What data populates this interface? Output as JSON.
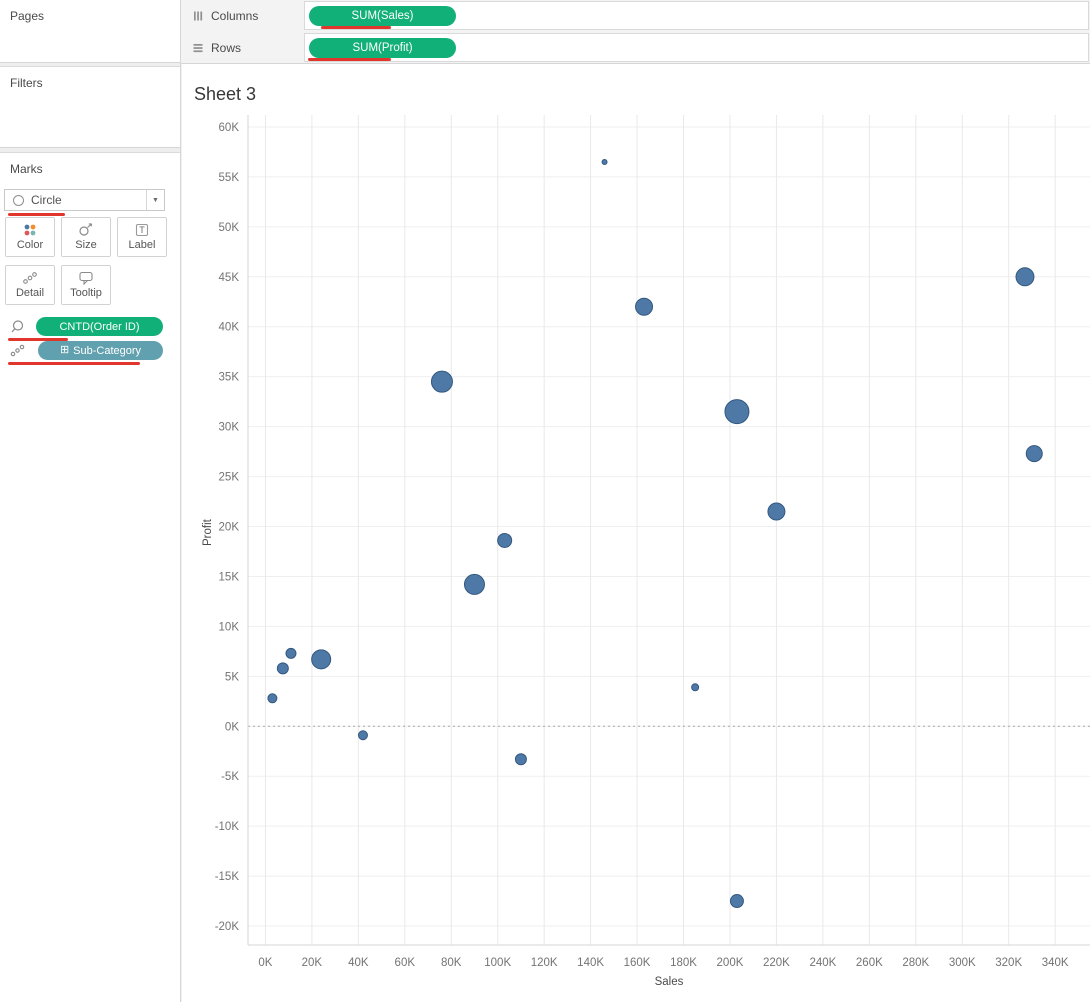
{
  "colors": {
    "annotation_red": "#e0362c",
    "pill_green": "#11b079",
    "pill_teal": "#61a0ae",
    "marker_fill": "#4e79a7",
    "marker_stroke": "#33587f"
  },
  "sidebar": {
    "pages": {
      "label": "Pages"
    },
    "filters": {
      "label": "Filters"
    },
    "marks": {
      "label": "Marks",
      "mark_type_dropdown": "Circle",
      "buttons": {
        "color": "Color",
        "size": "Size",
        "label": "Label",
        "detail": "Detail",
        "tooltip": "Tooltip"
      },
      "pills": {
        "size_pill": "CNTD(Order ID)",
        "detail_pill": "Sub-Category",
        "detail_pill_expand": "⊞"
      }
    }
  },
  "shelves": {
    "columns_label": "Columns",
    "columns_pill": "SUM(Sales)",
    "rows_label": "Rows",
    "rows_pill": "SUM(Profit)"
  },
  "sheet_title": "Sheet 3",
  "chart_data": {
    "type": "scatter",
    "title": "Sheet 3",
    "xlabel": "Sales",
    "ylabel": "Profit",
    "xlim": [
      -7500,
      355000
    ],
    "ylim": [
      -21900,
      61200
    ],
    "grid": true,
    "legend": "none",
    "marker_color": "#4e79a7",
    "marker_stroke": "#33587f",
    "x_ticks": {
      "values": [
        0,
        20000,
        40000,
        60000,
        80000,
        100000,
        120000,
        140000,
        160000,
        180000,
        200000,
        220000,
        240000,
        260000,
        280000,
        300000,
        320000,
        340000
      ],
      "labels": [
        "0K",
        "20K",
        "40K",
        "60K",
        "80K",
        "100K",
        "120K",
        "140K",
        "160K",
        "180K",
        "200K",
        "220K",
        "240K",
        "260K",
        "280K",
        "300K",
        "320K",
        "340K"
      ]
    },
    "y_ticks": {
      "values": [
        60000,
        55000,
        50000,
        45000,
        40000,
        35000,
        30000,
        25000,
        20000,
        15000,
        10000,
        5000,
        0,
        -5000,
        -10000,
        -15000,
        -20000
      ],
      "labels": [
        "60K",
        "55K",
        "50K",
        "45K",
        "40K",
        "35K",
        "30K",
        "25K",
        "20K",
        "15K",
        "10K",
        "5K",
        "0K",
        "-5K",
        "-10K",
        "-15K",
        "-20K"
      ]
    },
    "zero_line_y": 0,
    "points": [
      {
        "sales": 146000,
        "profit": 56500,
        "r": 2.5
      },
      {
        "sales": 327000,
        "profit": 45000,
        "r": 9
      },
      {
        "sales": 163000,
        "profit": 42000,
        "r": 8.5
      },
      {
        "sales": 76000,
        "profit": 34500,
        "r": 10.5
      },
      {
        "sales": 203000,
        "profit": 31500,
        "r": 12
      },
      {
        "sales": 331000,
        "profit": 27300,
        "r": 8
      },
      {
        "sales": 220000,
        "profit": 21500,
        "r": 8.5
      },
      {
        "sales": 103000,
        "profit": 18600,
        "r": 7
      },
      {
        "sales": 90000,
        "profit": 14200,
        "r": 10
      },
      {
        "sales": 24000,
        "profit": 6700,
        "r": 9.5
      },
      {
        "sales": 11000,
        "profit": 7300,
        "r": 5
      },
      {
        "sales": 7500,
        "profit": 5800,
        "r": 5.5
      },
      {
        "sales": 3000,
        "profit": 2800,
        "r": 4.5
      },
      {
        "sales": 185000,
        "profit": 3900,
        "r": 3.5
      },
      {
        "sales": 42000,
        "profit": -900,
        "r": 4.5
      },
      {
        "sales": 110000,
        "profit": -3300,
        "r": 5.5
      },
      {
        "sales": 203000,
        "profit": -17500,
        "r": 6.5
      }
    ]
  }
}
